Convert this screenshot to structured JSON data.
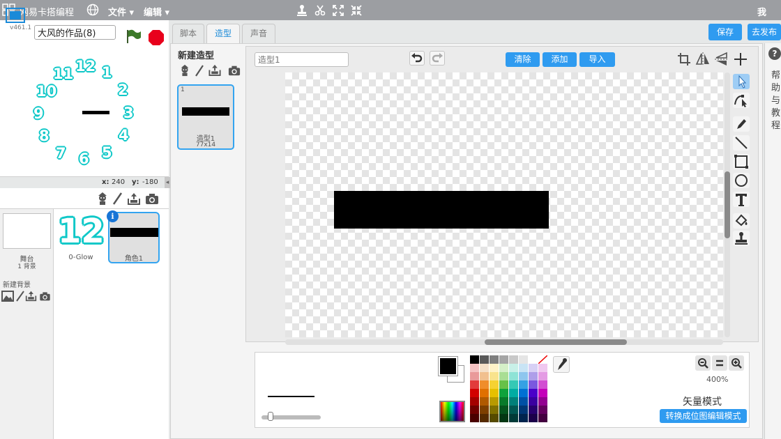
{
  "topbar": {
    "brand": "网易卡搭编程",
    "menu_file": "文件",
    "menu_edit": "编辑",
    "user": "我",
    "icons": [
      "logo-icon",
      "globe-icon",
      "stamp-icon",
      "scissors-icon",
      "grow-icon",
      "shrink-icon"
    ]
  },
  "stage": {
    "project_title": "大风的作品(8)",
    "version": "v461.1",
    "clock_numbers": [
      "12",
      "1",
      "2",
      "3",
      "4",
      "5",
      "6",
      "7",
      "8",
      "9",
      "10",
      "11"
    ],
    "coord_x_label": "x:",
    "coord_x": "240",
    "coord_y_label": "y:",
    "coord_y": "-180"
  },
  "sprites": {
    "stage_label": "舞台",
    "stage_backdrops": "1 背景",
    "new_backdrop": "新建背景",
    "items": [
      {
        "name": "0-Glow",
        "thumb_text": "12"
      },
      {
        "name": "角色1",
        "badge": "i"
      }
    ]
  },
  "tabs": [
    {
      "label": "脚本",
      "active": false
    },
    {
      "label": "造型",
      "active": true
    },
    {
      "label": "声音",
      "active": false
    }
  ],
  "actions": {
    "save": "保存",
    "publish": "去发布"
  },
  "costumes": {
    "new_title": "新建造型",
    "items": [
      {
        "index": "1",
        "name": "造型1",
        "size": "77x14"
      }
    ]
  },
  "paint": {
    "costume_name_placeholder": "造型1",
    "clear": "清除",
    "add": "添加",
    "import": "导入",
    "zoom": "400%",
    "mode_label": "矢量模式",
    "convert_button": "转换成位图编辑模式",
    "fg_color": "#000000",
    "bg_color": "#ffffff",
    "palette": [
      [
        "#000000",
        "#595959",
        "#7f7f7f",
        "#a5a5a5",
        "#c8c8c8",
        "#e5e5e5",
        "#ffffff",
        "transparent"
      ],
      [
        "#f5c3c3",
        "#f5e0c8",
        "#fff3c8",
        "#d5f0c8",
        "#c8f0e8",
        "#c8e4f5",
        "#d7d0f5",
        "#f0c8f0"
      ],
      [
        "#e99a9a",
        "#f1c08e",
        "#f9e38d",
        "#a9de94",
        "#8ee3d6",
        "#8ec6ee",
        "#ae9ee9",
        "#e49be4"
      ],
      [
        "#e23b3b",
        "#f08d2a",
        "#f6d232",
        "#67c148",
        "#35c9b5",
        "#35a1e4",
        "#7b58df",
        "#d24fd2"
      ],
      [
        "#d20000",
        "#e07000",
        "#e6c000",
        "#0fa23b",
        "#00aca3",
        "#0070d4",
        "#4a00c9",
        "#c400ba"
      ],
      [
        "#a40000",
        "#b05a00",
        "#b89a00",
        "#087a2a",
        "#00807a",
        "#0050a6",
        "#3a00a0",
        "#930091"
      ],
      [
        "#6f0000",
        "#7d3f00",
        "#807000",
        "#05541d",
        "#005753",
        "#003675",
        "#28006e",
        "#64005f"
      ],
      [
        "#4a0000",
        "#552a00",
        "#564b00",
        "#033713",
        "#003a38",
        "#00244e",
        "#1b004a",
        "#430040"
      ]
    ]
  },
  "help": {
    "icon": "?",
    "text": "帮助与教程"
  }
}
